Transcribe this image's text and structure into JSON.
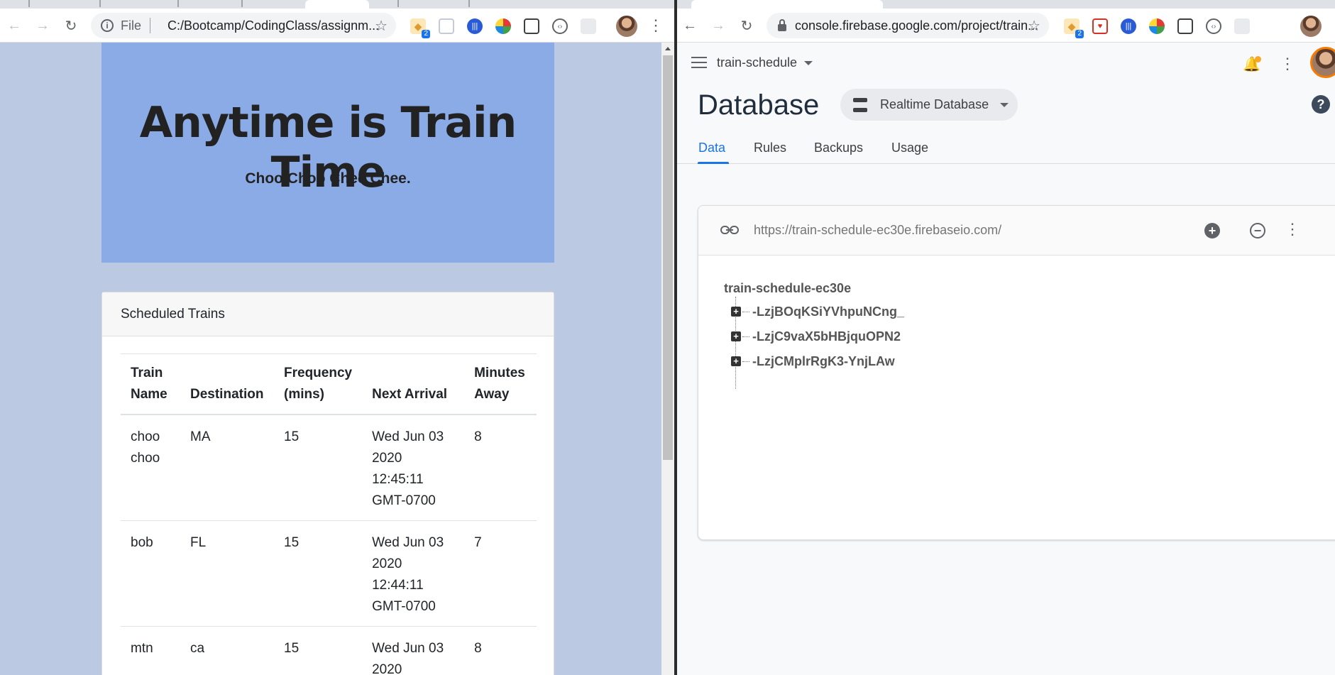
{
  "left_browser": {
    "omnibox": {
      "scheme": "File",
      "url": "C:/Bootcamp/CodingClass/assignm..."
    },
    "extension_badge": "2"
  },
  "right_browser": {
    "omnibox": {
      "url": "console.firebase.google.com/project/train..."
    },
    "extension_badge": "2"
  },
  "train_page": {
    "hero_title": "Anytime is Train Time",
    "hero_subtitle": "Choo Choo Chee Chee.",
    "card_title": "Scheduled Trains",
    "columns": [
      "Train Name",
      "Destination",
      "Frequency (mins)",
      "Next Arrival",
      "Minutes Away"
    ],
    "rows": [
      {
        "name": "choo choo",
        "destination": "MA",
        "frequency": "15",
        "next_arrival": "Wed Jun 03 2020 12:45:11 GMT-0700",
        "minutes_away": "8"
      },
      {
        "name": "bob",
        "destination": "FL",
        "frequency": "15",
        "next_arrival": "Wed Jun 03 2020 12:44:11 GMT-0700",
        "minutes_away": "7"
      },
      {
        "name": "mtn",
        "destination": "ca",
        "frequency": "15",
        "next_arrival": "Wed Jun 03 2020",
        "minutes_away": "8"
      }
    ]
  },
  "firebase": {
    "project_name": "train-schedule",
    "page_title": "Database",
    "db_selector": "Realtime Database",
    "tabs": [
      "Data",
      "Rules",
      "Backups",
      "Usage"
    ],
    "active_tab": "Data",
    "db_url": "https://train-schedule-ec30e.firebaseio.com/",
    "root_node": "train-schedule-ec30e",
    "children": [
      "-LzjBOqKSiYVhpuNCng_",
      "-LzjC9vaX5bHBjquOPN2",
      "-LzjCMplrRgK3-YnjLAw"
    ]
  },
  "colors": {
    "page_bg": "#bcc9e3",
    "hero_bg": "#8aabe6",
    "accent": "#1a73e8"
  }
}
